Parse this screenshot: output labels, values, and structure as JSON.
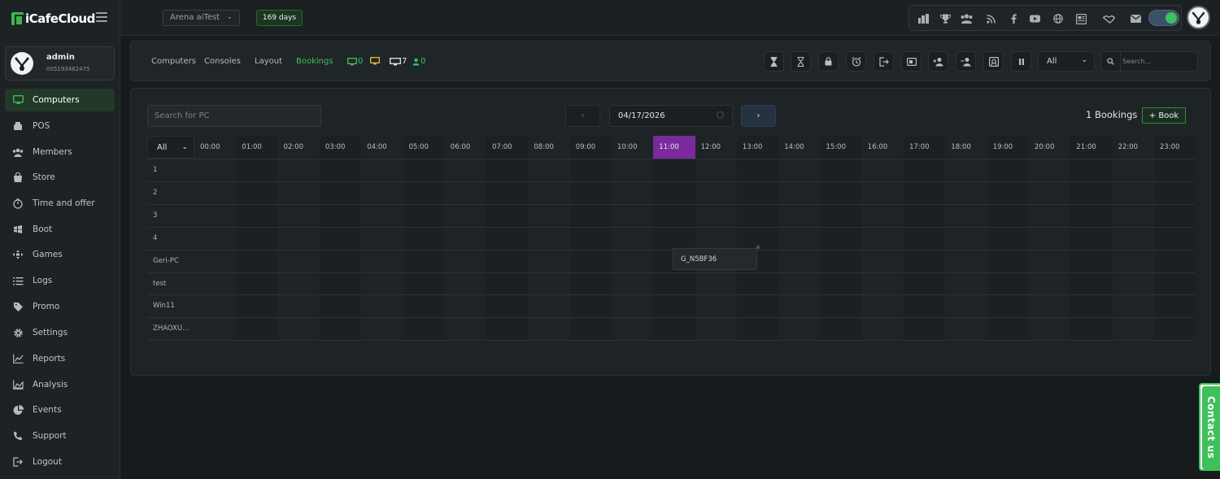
{
  "brand": {
    "name": "iCafeCloud"
  },
  "user": {
    "name": "admin",
    "id": "005193482475"
  },
  "sidebar": {
    "items": [
      {
        "key": "computers",
        "label": "Computers",
        "icon": "monitor-icon",
        "active": true
      },
      {
        "key": "pos",
        "label": "POS",
        "icon": "pos-icon",
        "active": false
      },
      {
        "key": "members",
        "label": "Members",
        "icon": "members-icon",
        "active": false
      },
      {
        "key": "store",
        "label": "Store",
        "icon": "store-icon",
        "active": false
      },
      {
        "key": "time-offer",
        "label": "Time and offer",
        "icon": "timer-icon",
        "active": false
      },
      {
        "key": "boot",
        "label": "Boot",
        "icon": "boot-icon",
        "active": false
      },
      {
        "key": "games",
        "label": "Games",
        "icon": "gamepad-icon",
        "active": false
      },
      {
        "key": "logs",
        "label": "Logs",
        "icon": "list-icon",
        "active": false
      },
      {
        "key": "promo",
        "label": "Promo",
        "icon": "tag-icon",
        "active": false
      },
      {
        "key": "settings",
        "label": "Settings",
        "icon": "gear-icon",
        "active": false
      },
      {
        "key": "reports",
        "label": "Reports",
        "icon": "line-chart-icon",
        "active": false
      },
      {
        "key": "analysis",
        "label": "Analysis",
        "icon": "area-chart-icon",
        "active": false
      },
      {
        "key": "events",
        "label": "Events",
        "icon": "pie-chart-icon",
        "active": false
      },
      {
        "key": "support",
        "label": "Support",
        "icon": "phone-icon",
        "active": false
      },
      {
        "key": "logout",
        "label": "Logout",
        "icon": "logout-icon",
        "active": false
      }
    ]
  },
  "topbar": {
    "arena": "Arena aiTest",
    "days": "169 days",
    "social_icons": [
      "dashboard-icon",
      "trophy-icon",
      "group-icon",
      "rss-icon",
      "facebook-icon",
      "youtube-icon",
      "globe-icon",
      "news-icon",
      "handshake-icon",
      "mail-icon"
    ]
  },
  "subnav": {
    "tabs": [
      {
        "label": "Computers",
        "active": false
      },
      {
        "label": "Consoles",
        "active": false
      },
      {
        "label": "Layout",
        "active": false
      },
      {
        "label": "Bookings",
        "active": true
      }
    ],
    "stats": [
      {
        "icon": "monitor-green-icon",
        "value": "0",
        "color": "#3ec15a"
      },
      {
        "icon": "monitor-yellow-icon",
        "value": "",
        "color": "#e0c030"
      },
      {
        "icon": "monitor-white-icon",
        "value": "7",
        "color": "#e4e8ea"
      },
      {
        "icon": "user-green-icon",
        "value": "0",
        "color": "#3ec15a"
      }
    ],
    "tools": [
      "hourglass-full-icon",
      "hourglass-empty-icon",
      "lock-icon",
      "alarm-icon",
      "exit-icon",
      "card-icon",
      "user-add-icon",
      "user-remove-icon",
      "screenshot-icon",
      "pause-icon"
    ],
    "filter": "All",
    "search_placeholder": "Search..."
  },
  "bookings": {
    "pc_search_placeholder": "Search for PC",
    "date": "04/17/2026",
    "count_label": "1 Bookings",
    "book_label": "+ Book",
    "filter": "All",
    "hours": [
      "00:00",
      "01:00",
      "02:00",
      "03:00",
      "04:00",
      "05:00",
      "06:00",
      "07:00",
      "08:00",
      "09:00",
      "10:00",
      "11:00",
      "12:00",
      "13:00",
      "14:00",
      "15:00",
      "16:00",
      "17:00",
      "18:00",
      "19:00",
      "20:00",
      "21:00",
      "22:00",
      "23:00"
    ],
    "current_hour": "11:00",
    "pcs": [
      "1",
      "2",
      "3",
      "4",
      "Geri-PC",
      "test",
      "Win11",
      "ZHAOXU..."
    ],
    "booking": {
      "pc": "Geri-PC",
      "label": "G_N5BF36"
    }
  },
  "contact": {
    "label": "Contact us"
  },
  "colors": {
    "accent": "#3ec15a",
    "current_hour": "#7a2a9c",
    "background": "#171b1d"
  }
}
